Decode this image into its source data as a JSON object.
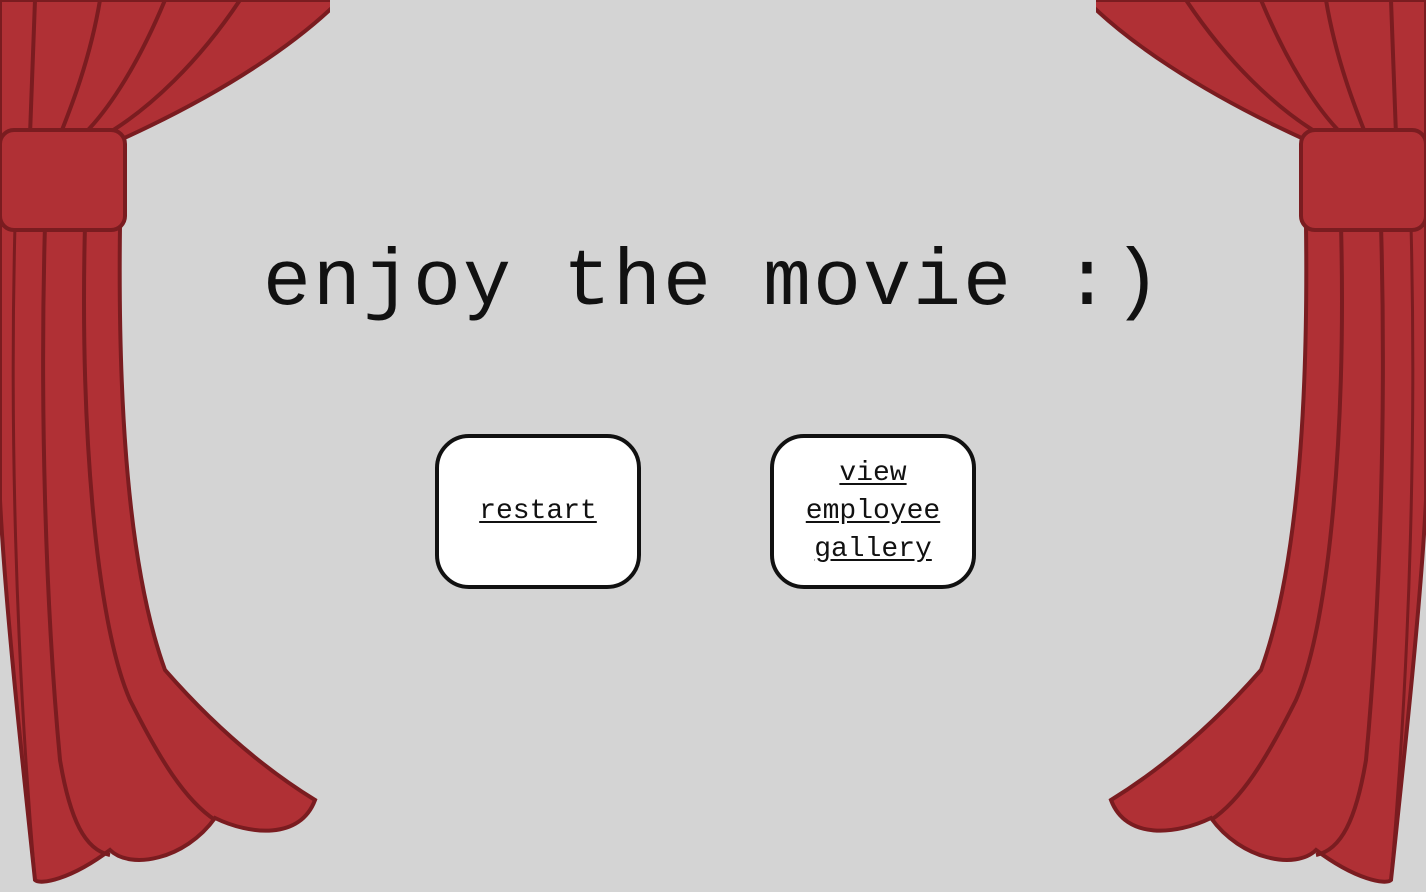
{
  "headline": "enjoy the movie :)",
  "buttons": {
    "restart_label": "restart",
    "gallery_label": "view employee gallery"
  },
  "colors": {
    "background": "#d4d4d4",
    "curtain_fill": "#b03035",
    "curtain_stroke": "#7a1c20",
    "button_fill": "#ffffff",
    "button_border": "#111111"
  },
  "icons": {
    "left_curtain": "theater-curtain-left-icon",
    "right_curtain": "theater-curtain-right-icon"
  }
}
